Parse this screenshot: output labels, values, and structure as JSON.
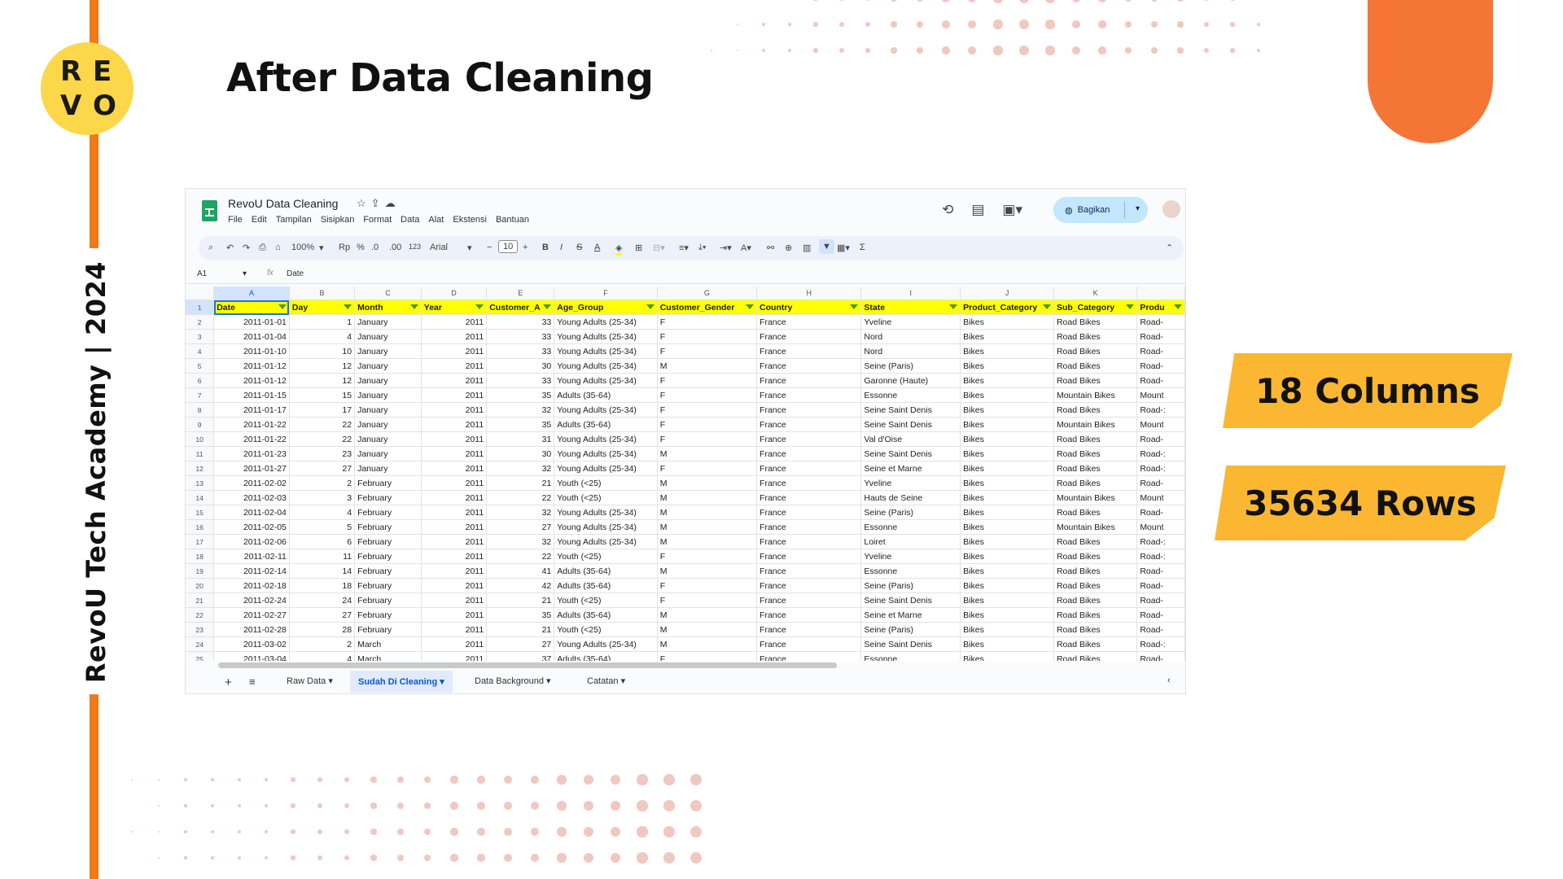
{
  "slide": {
    "title": "After Data Cleaning",
    "side_text": "RevoU Tech Academy | 2024",
    "logo_letters": [
      "R",
      "E",
      "V",
      "O"
    ],
    "badges": [
      "18 Columns",
      "35634 Rows"
    ]
  },
  "sheets": {
    "doc_title": "RevoU Data Cleaning",
    "menus": [
      "File",
      "Edit",
      "Tampilan",
      "Sisipkan",
      "Format",
      "Data",
      "Alat",
      "Ekstensi",
      "Bantuan"
    ],
    "share_label": "Bagikan",
    "toolbar": {
      "zoom": "100%",
      "currency": "Rp",
      "percent": "%",
      "dec_minus": ".0",
      "dec_plus": ".00",
      "num_format": "123",
      "font": "Arial",
      "font_size": "10",
      "sigma": "Σ"
    },
    "name_box": "A1",
    "formula": "Date",
    "column_letters": [
      "A",
      "B",
      "C",
      "D",
      "E",
      "F",
      "G",
      "H",
      "I",
      "J",
      "K",
      ""
    ],
    "headers": [
      "Date",
      "Day",
      "Month",
      "Year",
      "Customer_A",
      "Age_Group",
      "Customer_Gender",
      "Country",
      "State",
      "Product_Category",
      "Sub_Category",
      "Produ"
    ],
    "rows": [
      [
        "2011-01-01",
        "1",
        "January",
        "2011",
        "33",
        "Young Adults (25-34)",
        "F",
        "France",
        "Yveline",
        "Bikes",
        "Road Bikes",
        "Road-"
      ],
      [
        "2011-01-04",
        "4",
        "January",
        "2011",
        "33",
        "Young Adults (25-34)",
        "F",
        "France",
        "Nord",
        "Bikes",
        "Road Bikes",
        "Road-"
      ],
      [
        "2011-01-10",
        "10",
        "January",
        "2011",
        "33",
        "Young Adults (25-34)",
        "F",
        "France",
        "Nord",
        "Bikes",
        "Road Bikes",
        "Road-"
      ],
      [
        "2011-01-12",
        "12",
        "January",
        "2011",
        "30",
        "Young Adults (25-34)",
        "M",
        "France",
        "Seine (Paris)",
        "Bikes",
        "Road Bikes",
        "Road-"
      ],
      [
        "2011-01-12",
        "12",
        "January",
        "2011",
        "33",
        "Young Adults (25-34)",
        "F",
        "France",
        "Garonne (Haute)",
        "Bikes",
        "Road Bikes",
        "Road-"
      ],
      [
        "2011-01-15",
        "15",
        "January",
        "2011",
        "35",
        "Adults (35-64)",
        "F",
        "France",
        "Essonne",
        "Bikes",
        "Mountain Bikes",
        "Mount"
      ],
      [
        "2011-01-17",
        "17",
        "January",
        "2011",
        "32",
        "Young Adults (25-34)",
        "F",
        "France",
        "Seine Saint Denis",
        "Bikes",
        "Road Bikes",
        "Road-:"
      ],
      [
        "2011-01-22",
        "22",
        "January",
        "2011",
        "35",
        "Adults (35-64)",
        "F",
        "France",
        "Seine Saint Denis",
        "Bikes",
        "Mountain Bikes",
        "Mount"
      ],
      [
        "2011-01-22",
        "22",
        "January",
        "2011",
        "31",
        "Young Adults (25-34)",
        "F",
        "France",
        "Val d'Oise",
        "Bikes",
        "Road Bikes",
        "Road-"
      ],
      [
        "2011-01-23",
        "23",
        "January",
        "2011",
        "30",
        "Young Adults (25-34)",
        "M",
        "France",
        "Seine Saint Denis",
        "Bikes",
        "Road Bikes",
        "Road-:"
      ],
      [
        "2011-01-27",
        "27",
        "January",
        "2011",
        "32",
        "Young Adults (25-34)",
        "F",
        "France",
        "Seine et Marne",
        "Bikes",
        "Road Bikes",
        "Road-:"
      ],
      [
        "2011-02-02",
        "2",
        "February",
        "2011",
        "21",
        "Youth (<25)",
        "M",
        "France",
        "Yveline",
        "Bikes",
        "Road Bikes",
        "Road-"
      ],
      [
        "2011-02-03",
        "3",
        "February",
        "2011",
        "22",
        "Youth (<25)",
        "M",
        "France",
        "Hauts de Seine",
        "Bikes",
        "Mountain Bikes",
        "Mount"
      ],
      [
        "2011-02-04",
        "4",
        "February",
        "2011",
        "32",
        "Young Adults (25-34)",
        "M",
        "France",
        "Seine (Paris)",
        "Bikes",
        "Road Bikes",
        "Road-"
      ],
      [
        "2011-02-05",
        "5",
        "February",
        "2011",
        "27",
        "Young Adults (25-34)",
        "M",
        "France",
        "Essonne",
        "Bikes",
        "Mountain Bikes",
        "Mount"
      ],
      [
        "2011-02-06",
        "6",
        "February",
        "2011",
        "32",
        "Young Adults (25-34)",
        "M",
        "France",
        "Loiret",
        "Bikes",
        "Road Bikes",
        "Road-:"
      ],
      [
        "2011-02-11",
        "11",
        "February",
        "2011",
        "22",
        "Youth (<25)",
        "F",
        "France",
        "Yveline",
        "Bikes",
        "Road Bikes",
        "Road-:"
      ],
      [
        "2011-02-14",
        "14",
        "February",
        "2011",
        "41",
        "Adults (35-64)",
        "M",
        "France",
        "Essonne",
        "Bikes",
        "Road Bikes",
        "Road-"
      ],
      [
        "2011-02-18",
        "18",
        "February",
        "2011",
        "42",
        "Adults (35-64)",
        "F",
        "France",
        "Seine (Paris)",
        "Bikes",
        "Road Bikes",
        "Road-"
      ],
      [
        "2011-02-24",
        "24",
        "February",
        "2011",
        "21",
        "Youth (<25)",
        "F",
        "France",
        "Seine Saint Denis",
        "Bikes",
        "Road Bikes",
        "Road-"
      ],
      [
        "2011-02-27",
        "27",
        "February",
        "2011",
        "35",
        "Adults (35-64)",
        "M",
        "France",
        "Seine et Marne",
        "Bikes",
        "Road Bikes",
        "Road-"
      ],
      [
        "2011-02-28",
        "28",
        "February",
        "2011",
        "21",
        "Youth (<25)",
        "M",
        "France",
        "Seine (Paris)",
        "Bikes",
        "Road Bikes",
        "Road-"
      ],
      [
        "2011-03-02",
        "2",
        "March",
        "2011",
        "27",
        "Young Adults (25-34)",
        "M",
        "France",
        "Seine Saint Denis",
        "Bikes",
        "Road Bikes",
        "Road-:"
      ],
      [
        "2011-03-04",
        "4",
        "March",
        "2011",
        "37",
        "Adults (35-64)",
        "F",
        "France",
        "Essonne",
        "Bikes",
        "Road Bikes",
        "Road-"
      ]
    ],
    "sheet_tabs": [
      "Raw Data",
      "Sudah Di Cleaning",
      "Data Background",
      "Catatan"
    ],
    "active_tab": "Sudah Di Cleaning"
  },
  "colors": {
    "accent_orange": "#f07a16",
    "badge_yellow": "#fbb731",
    "header_yellow": "#ffff00",
    "logo_yellow": "#fcd74a"
  }
}
